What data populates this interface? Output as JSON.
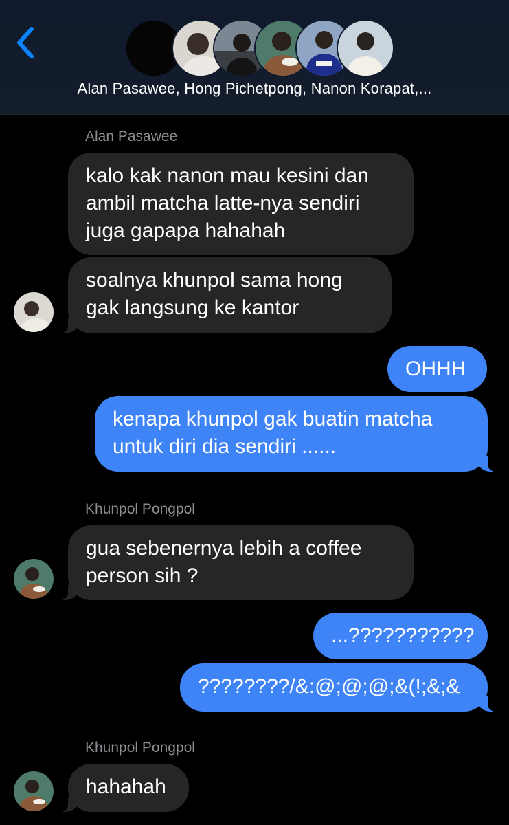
{
  "header": {
    "back_icon": "chevron-left-icon",
    "accent_color": "#0a84ff",
    "title": "Alan Pasawee, Hong Pichetpong, Nanon Korapat,..."
  },
  "messages": [
    {
      "sender": "Alan Pasawee"
    },
    {
      "text": "kalo kak nanon mau kesini dan\nambil matcha latte-nya sendiri\njuga gapapa hahahah"
    },
    {
      "text": "soalnya khunpol sama hong\ngak langsung ke kantor"
    },
    {
      "text": "OHHH"
    },
    {
      "text": "kenapa khunpol gak buatin matcha\nuntuk diri dia sendiri ......"
    },
    {
      "sender": "Khunpol Pongpol"
    },
    {
      "text": "gua sebenernya lebih a coffee\nperson sih ?"
    },
    {
      "text": "...???????????"
    },
    {
      "text": "????????/&:@;@;@;&(!;&;&"
    },
    {
      "sender": "Khunpol Pongpol"
    },
    {
      "text": "hahahah"
    }
  ],
  "colors": {
    "incoming_bubble": "#262629",
    "outgoing_bubble": "#3f84f7",
    "sender_label": "#8d8d93",
    "background": "#000000"
  }
}
